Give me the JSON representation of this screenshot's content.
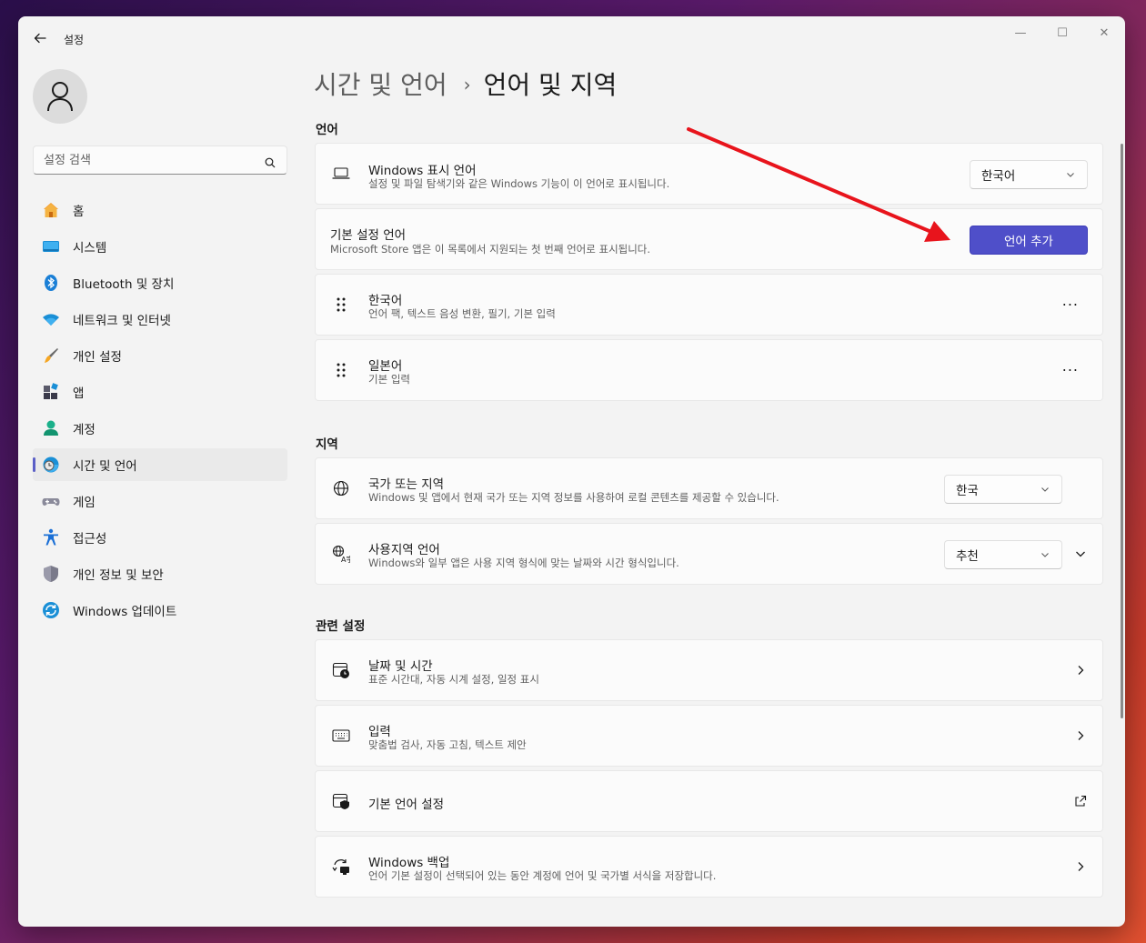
{
  "window": {
    "title": "설정",
    "controls": {
      "minimize": "—",
      "maximize": "☐",
      "close": "✕"
    }
  },
  "sidebar": {
    "search_placeholder": "설정 검색",
    "items": [
      {
        "label": "홈",
        "icon": "home-icon"
      },
      {
        "label": "시스템",
        "icon": "system-icon"
      },
      {
        "label": "Bluetooth 및 장치",
        "icon": "bluetooth-icon"
      },
      {
        "label": "네트워크 및 인터넷",
        "icon": "wifi-icon"
      },
      {
        "label": "개인 설정",
        "icon": "brush-icon"
      },
      {
        "label": "앱",
        "icon": "apps-icon"
      },
      {
        "label": "계정",
        "icon": "account-icon"
      },
      {
        "label": "시간 및 언어",
        "icon": "time-language-icon",
        "active": true
      },
      {
        "label": "게임",
        "icon": "gamepad-icon"
      },
      {
        "label": "접근성",
        "icon": "accessibility-icon"
      },
      {
        "label": "개인 정보 및 보안",
        "icon": "shield-icon"
      },
      {
        "label": "Windows 업데이트",
        "icon": "update-icon"
      }
    ]
  },
  "breadcrumb": {
    "parent": "시간 및 언어",
    "separator": "›",
    "current": "언어 및 지역"
  },
  "sections": {
    "language": "언어",
    "region": "지역",
    "related": "관련 설정"
  },
  "language": {
    "display": {
      "title": "Windows 표시 언어",
      "desc": "설정 및 파일 탐색기와 같은 Windows 기능이 이 언어로 표시됩니다.",
      "value": "한국어"
    },
    "preferred": {
      "title": "기본 설정 언어",
      "desc": "Microsoft Store 앱은 이 목록에서 지원되는 첫 번째 언어로 표시됩니다.",
      "button": "언어 추가"
    },
    "list": [
      {
        "title": "한국어",
        "desc": "언어 팩, 텍스트 음성 변환, 필기, 기본 입력",
        "more": "···"
      },
      {
        "title": "일본어",
        "desc": "기본 입력",
        "more": "···"
      }
    ]
  },
  "region": {
    "country": {
      "title": "국가 또는 지역",
      "desc": "Windows 및 앱에서 현재 국가 또는 지역 정보를 사용하여 로컬 콘텐츠를 제공할 수 있습니다.",
      "value": "한국"
    },
    "format": {
      "title": "사용지역 언어",
      "desc": "Windows와 일부 앱은 사용 지역 형식에 맞는 날짜와 시간 형식입니다.",
      "value": "추천"
    }
  },
  "related": [
    {
      "title": "날짜 및 시간",
      "desc": "표준 시간대, 자동 시계 설정, 일정 표시",
      "icon": "calendar-clock-icon",
      "action": "chevron"
    },
    {
      "title": "입력",
      "desc": "맞춤법 검사, 자동 고침, 텍스트 제안",
      "icon": "keyboard-icon",
      "action": "chevron"
    },
    {
      "title": "기본 언어 설정",
      "desc": "",
      "icon": "admin-language-icon",
      "action": "external"
    },
    {
      "title": "Windows 백업",
      "desc": "언어 기본 설정이 선택되어 있는 동안 계정에 언어 및 국가별 서식을 저장합니다.",
      "icon": "backup-icon",
      "action": "chevron"
    }
  ],
  "colors": {
    "accent": "#4f4fc9",
    "annotation_arrow": "#e8141c"
  }
}
